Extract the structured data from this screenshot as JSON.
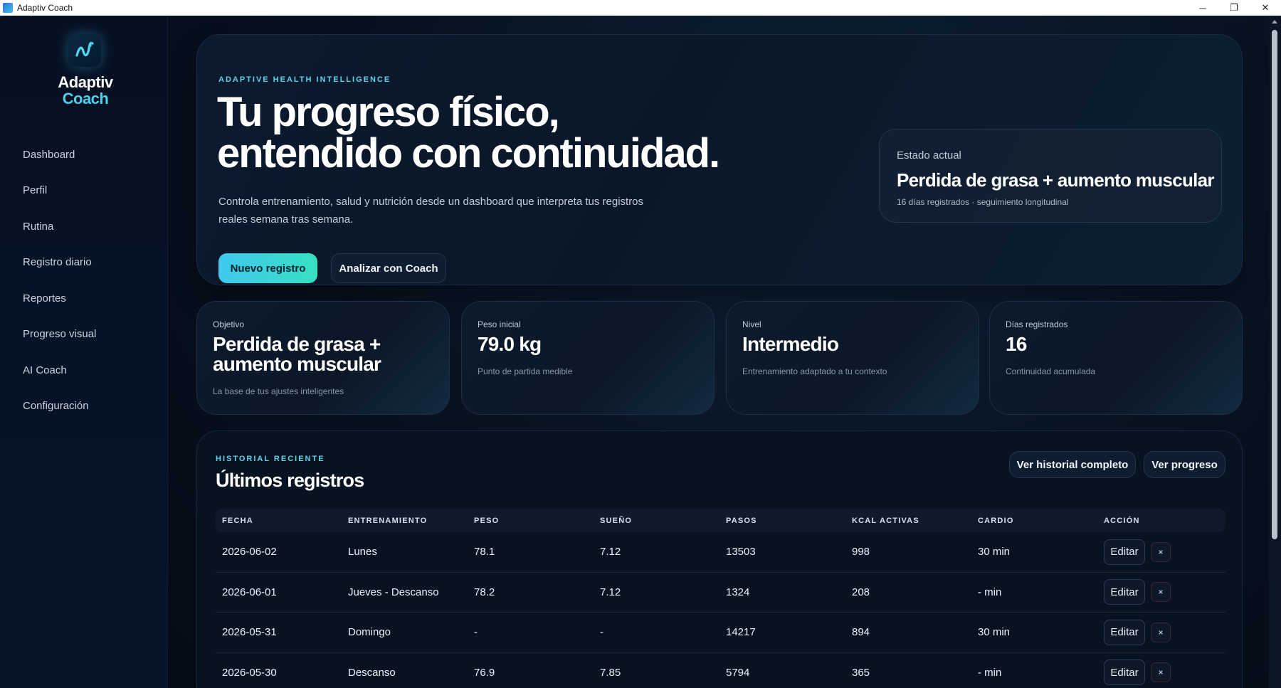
{
  "window": {
    "title": "Adaptiv Coach",
    "controls": {
      "minimize": "─",
      "maximize": "❐",
      "close": "✕"
    }
  },
  "brand": {
    "line1": "Adaptiv",
    "line2": "Coach",
    "logo_icon": "adaptiv-wave-logo"
  },
  "nav": [
    {
      "label": "Dashboard"
    },
    {
      "label": "Perfil"
    },
    {
      "label": "Rutina"
    },
    {
      "label": "Registro diario"
    },
    {
      "label": "Reportes"
    },
    {
      "label": "Progreso visual"
    },
    {
      "label": "AI Coach"
    },
    {
      "label": "Configuración"
    }
  ],
  "hero": {
    "eyebrow": "ADAPTIVE HEALTH INTELLIGENCE",
    "title_line1": "Tu progreso físico,",
    "title_line2": "entendido con continuidad.",
    "description": "Controla entrenamiento, salud y nutrición desde un dashboard que interpreta tus registros reales semana tras semana.",
    "primary_button": "Nuevo registro",
    "secondary_button": "Analizar con Coach",
    "status": {
      "label": "Estado actual",
      "value": "Perdida de grasa + aumento muscular",
      "sub": "16 días registrados · seguimiento longitudinal"
    }
  },
  "stats": [
    {
      "label": "Objetivo",
      "value": "Perdida de grasa + aumento muscular",
      "sub": "La base de tus ajustes inteligentes"
    },
    {
      "label": "Peso inicial",
      "value": "79.0 kg",
      "sub": "Punto de partida medible"
    },
    {
      "label": "Nivel",
      "value": "Intermedio",
      "sub": "Entrenamiento adaptado a tu contexto"
    },
    {
      "label": "Días registrados",
      "value": "16",
      "sub": "Continuidad acumulada"
    }
  ],
  "history": {
    "eyebrow": "HISTORIAL RECIENTE",
    "title": "Últimos registros",
    "btn_history": "Ver historial completo",
    "btn_progress": "Ver progreso",
    "columns": [
      "FECHA",
      "ENTRENAMIENTO",
      "PESO",
      "SUEÑO",
      "PASOS",
      "KCAL ACTIVAS",
      "CARDIO",
      "ACCIÓN"
    ],
    "rows": [
      [
        "2026-06-02",
        "Lunes",
        "78.1",
        "7.12",
        "13503",
        "998",
        "30 min"
      ],
      [
        "2026-06-01",
        "Jueves - Descanso",
        "78.2",
        "7.12",
        "1324",
        "208",
        "- min"
      ],
      [
        "2026-05-31",
        "Domingo",
        "-",
        "-",
        "14217",
        "894",
        "30 min"
      ],
      [
        "2026-05-30",
        "Descanso",
        "76.9",
        "7.85",
        "5794",
        "365",
        "- min"
      ]
    ],
    "edit_label": "Editar",
    "delete_label": "×"
  }
}
